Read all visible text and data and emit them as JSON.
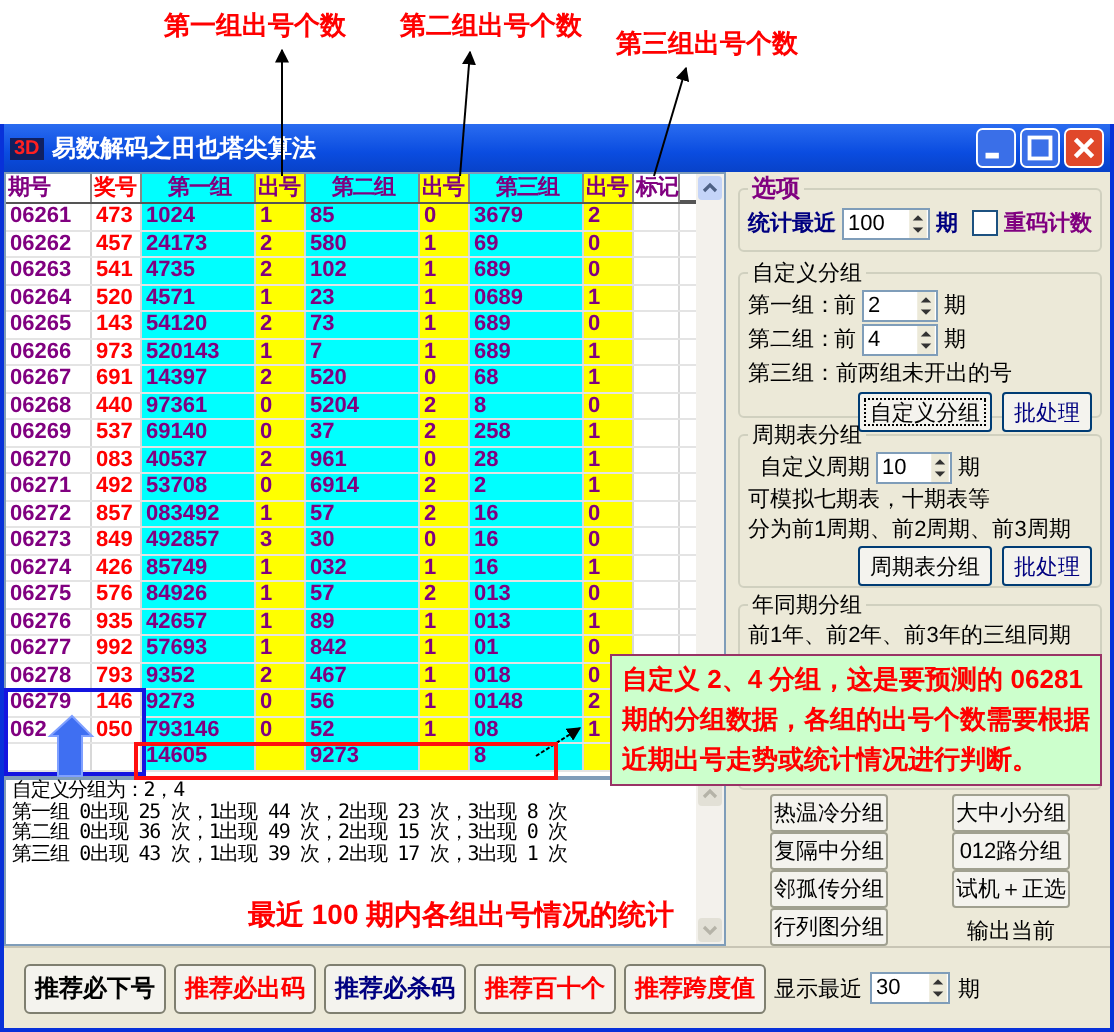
{
  "annotations": {
    "labels": [
      "第一组出号个数",
      "第二组出号个数",
      "第三组出号个数"
    ],
    "callout": "自定义 2、4 分组，这是要预测的 06281 期的分组数据，各组的出号个数需要根据近期出号走势或统计情况进行判断。"
  },
  "window": {
    "logo": "3D",
    "title": "易数解码之田也塔尖算法"
  },
  "table": {
    "columns": [
      "期号",
      "奖号",
      "第一组",
      "出号",
      "第二组",
      "出号",
      "第三组",
      "出号",
      "标记"
    ],
    "rows": [
      [
        "06261",
        "473",
        "1024",
        "1",
        "85",
        "0",
        "3679",
        "2"
      ],
      [
        "06262",
        "457",
        "24173",
        "2",
        "580",
        "1",
        "69",
        "0"
      ],
      [
        "06263",
        "541",
        "4735",
        "2",
        "102",
        "1",
        "689",
        "0"
      ],
      [
        "06264",
        "520",
        "4571",
        "1",
        "23",
        "1",
        "0689",
        "1"
      ],
      [
        "06265",
        "143",
        "54120",
        "2",
        "73",
        "1",
        "689",
        "0"
      ],
      [
        "06266",
        "973",
        "520143",
        "1",
        "7",
        "1",
        "689",
        "1"
      ],
      [
        "06267",
        "691",
        "14397",
        "2",
        "520",
        "0",
        "68",
        "1"
      ],
      [
        "06268",
        "440",
        "97361",
        "0",
        "5204",
        "2",
        "8",
        "0"
      ],
      [
        "06269",
        "537",
        "69140",
        "0",
        "37",
        "2",
        "258",
        "1"
      ],
      [
        "06270",
        "083",
        "40537",
        "2",
        "961",
        "0",
        "28",
        "1"
      ],
      [
        "06271",
        "492",
        "53708",
        "0",
        "6914",
        "2",
        "2",
        "1"
      ],
      [
        "06272",
        "857",
        "083492",
        "1",
        "57",
        "2",
        "16",
        "0"
      ],
      [
        "06273",
        "849",
        "492857",
        "3",
        "30",
        "0",
        "16",
        "0"
      ],
      [
        "06274",
        "426",
        "85749",
        "1",
        "032",
        "1",
        "16",
        "1"
      ],
      [
        "06275",
        "576",
        "84926",
        "1",
        "57",
        "2",
        "013",
        "0"
      ],
      [
        "06276",
        "935",
        "42657",
        "1",
        "89",
        "1",
        "013",
        "1"
      ],
      [
        "06277",
        "992",
        "57693",
        "1",
        "842",
        "1",
        "01",
        "0"
      ],
      [
        "06278",
        "793",
        "9352",
        "2",
        "467",
        "1",
        "018",
        "0"
      ],
      [
        "06279",
        "146",
        "9273",
        "0",
        "56",
        "1",
        "0148",
        "2"
      ],
      [
        "062",
        "050",
        "793146",
        "0",
        "52",
        "1",
        "08",
        "1"
      ]
    ],
    "summary": [
      "14605",
      "9273",
      "8"
    ]
  },
  "stats": {
    "lines": [
      "自定义分组为：2，4",
      "第一组 0出现 25 次，1出现 44 次，2出现 23 次，3出现 8 次",
      "第二组 0出现 36 次，1出现 49 次，2出现 15 次，3出现 0 次",
      "第三组 0出现 43 次，1出现 39 次，2出现 17 次，3出现 1 次"
    ],
    "caption": "最近 100 期内各组出号情况的统计"
  },
  "options": {
    "legend": "选项",
    "recent_label": "统计最近",
    "recent_value": "100",
    "recent_unit": "期",
    "repeat": {
      "label": "重码计数",
      "checked": false
    }
  },
  "custom_group": {
    "legend": "自定义分组",
    "rows": [
      {
        "label": "第一组：",
        "prefix": "前",
        "value": "2",
        "unit": "期"
      },
      {
        "label": "第二组：",
        "prefix": "前",
        "value": "4",
        "unit": "期"
      }
    ],
    "note": "第三组：前两组未开出的号",
    "buttons": [
      "自定义分组",
      "批处理"
    ]
  },
  "cycle_group": {
    "legend": "周期表分组",
    "label": "自定义周期",
    "value": "10",
    "unit": "期",
    "notes": [
      "可模拟七期表，十期表等",
      "分为前1周期、前2周期、前3周期"
    ],
    "buttons": [
      "周期表分组",
      "批处理"
    ]
  },
  "year_group": {
    "legend": "年同期分组",
    "note": "前1年、前2年、前3年的三组同期"
  },
  "group_buttons": {
    "left": [
      "热温冷分组",
      "复隔中分组",
      "邻孤传分组",
      "行列图分组"
    ],
    "right": [
      "大中小分组",
      "012路分组",
      "试机＋正选"
    ],
    "output_label": "输出当前"
  },
  "bottom": {
    "buttons": [
      {
        "label": "推荐必下号",
        "color": "#000000"
      },
      {
        "label": "推荐必出码",
        "color": "#ff0000"
      },
      {
        "label": "推荐必杀码",
        "color": "#000080"
      },
      {
        "label": "推荐百十个",
        "color": "#ff0000"
      },
      {
        "label": "推荐跨度值",
        "color": "#ff0000"
      }
    ],
    "recent_label": "显示最近",
    "recent_value": "30",
    "unit": "期"
  }
}
